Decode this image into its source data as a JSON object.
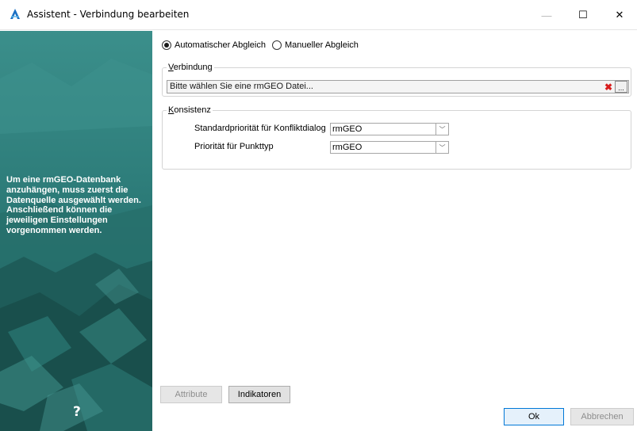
{
  "window": {
    "title": "Assistent - Verbindung bearbeiten",
    "minimize_glyph": "—",
    "maximize_glyph": "☐",
    "close_glyph": "✕"
  },
  "sidebar": {
    "description": "Um eine rmGEO-Datenbank anzuhängen, muss zuerst die Datenquelle ausgewählt werden. Anschließend können die jeweiligen Einstellungen vorgenommen werden.",
    "help_glyph": "?"
  },
  "mode": {
    "options": [
      {
        "label": "Automatischer Abgleich",
        "checked": true
      },
      {
        "label": "Manueller Abgleich",
        "checked": false
      }
    ]
  },
  "connection": {
    "group_title_mnemonic": "V",
    "group_title_rest": "erbindung",
    "file_placeholder": "Bitte wählen Sie eine rmGEO Datei...",
    "clear_glyph": "✖",
    "browse_label": "..."
  },
  "consistency": {
    "group_title_mnemonic": "K",
    "group_title_rest": "onsistenz",
    "conflict_priority_label": "Standardpriorität für Konfliktdialog",
    "conflict_priority_value": "rmGEO",
    "point_type_priority_label": "Priorität für Punkttyp",
    "point_type_priority_value": "rmGEO",
    "chevron_glyph": "﹀"
  },
  "footer": {
    "attribute_label": "Attribute",
    "indicators_label": "Indikatoren",
    "ok_label": "Ok",
    "cancel_label": "Abbrechen"
  },
  "colors": {
    "accent": "#0078d7",
    "sidebar_teal": "#2a7b78",
    "clear_red": "#d81c1c"
  }
}
